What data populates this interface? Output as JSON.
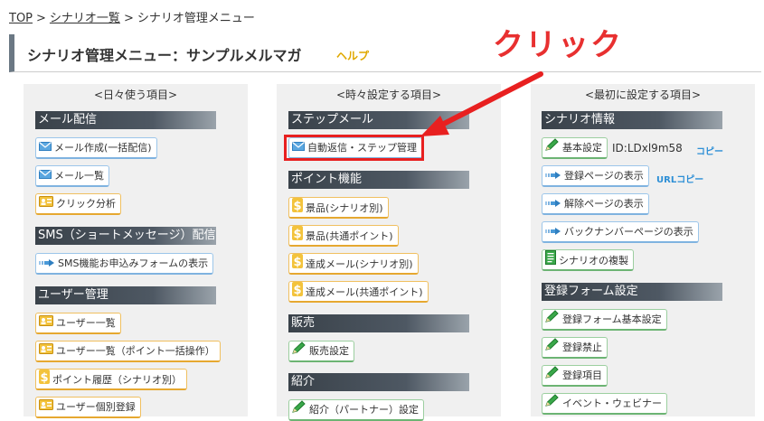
{
  "breadcrumb": {
    "top": "TOP",
    "sep": ">",
    "list": "シナリオ一覧",
    "current": "シナリオ管理メニュー"
  },
  "header": {
    "title": "シナリオ管理メニュー：サンプルメルマガ",
    "help": "ヘルプ"
  },
  "annotation": {
    "text": "クリック"
  },
  "col1": {
    "heading": "<日々使う項目>",
    "sections": [
      {
        "title": "メール配信",
        "items": [
          "メール作成(一括配信)",
          "メール一覧",
          "クリック分析"
        ]
      },
      {
        "title": "SMS（ショートメッセージ）配信",
        "items": [
          "SMS機能お申込みフォームの表示"
        ]
      },
      {
        "title": "ユーザー管理",
        "items": [
          "ユーザー一覧",
          "ユーザー一覧（ポイント一括操作）",
          "ポイント履歴（シナリオ別）",
          "ユーザー個別登録"
        ]
      }
    ]
  },
  "col2": {
    "heading": "<時々設定する項目>",
    "sections": [
      {
        "title": "ステップメール",
        "items": [
          "自動返信・ステップ管理"
        ]
      },
      {
        "title": "ポイント機能",
        "items": [
          "景品(シナリオ別)",
          "景品(共通ポイント)",
          "達成メール(シナリオ別)",
          "達成メール(共通ポイント)"
        ]
      },
      {
        "title": "販売",
        "items": [
          "販売設定"
        ]
      },
      {
        "title": "紹介",
        "items": [
          "紹介（パートナー）設定"
        ]
      }
    ]
  },
  "col3": {
    "heading": "<最初に設定する項目>",
    "sections": [
      {
        "title": "シナリオ情報",
        "items": [
          "基本設定",
          "登録ページの表示",
          "解除ページの表示",
          "バックナンバーページの表示",
          "シナリオの複製"
        ]
      },
      {
        "title": "登録フォーム設定",
        "items": [
          "登録フォーム基本設定",
          "登録禁止",
          "登録項目",
          "イベント・ウェビナー"
        ]
      }
    ],
    "scenario_id": "ID:LDxl9m58",
    "copy_label": "コピー",
    "url_copy_label": "URLコピー"
  }
}
